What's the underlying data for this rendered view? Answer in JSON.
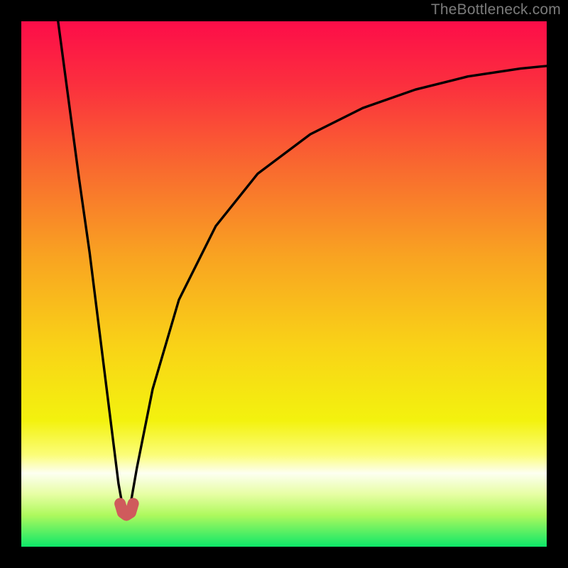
{
  "watermark": "TheBottleneck.com",
  "colors": {
    "frame": "#000000",
    "curve": "#000000",
    "marker": "#cf5b5c",
    "marker_outline": "#b94a4b",
    "gradient_stops": [
      {
        "offset": 0.0,
        "color": "#fd0d49"
      },
      {
        "offset": 0.12,
        "color": "#fb2f3e"
      },
      {
        "offset": 0.28,
        "color": "#f96a2f"
      },
      {
        "offset": 0.45,
        "color": "#f9a421"
      },
      {
        "offset": 0.62,
        "color": "#f9d317"
      },
      {
        "offset": 0.76,
        "color": "#f3f20e"
      },
      {
        "offset": 0.825,
        "color": "#fbfd78"
      },
      {
        "offset": 0.86,
        "color": "#fdfff1"
      },
      {
        "offset": 0.9,
        "color": "#e7fea4"
      },
      {
        "offset": 0.94,
        "color": "#aef95d"
      },
      {
        "offset": 1.0,
        "color": "#0de769"
      }
    ]
  },
  "chart_data": {
    "type": "line",
    "title": "",
    "xlabel": "",
    "ylabel": "",
    "xlim": [
      0,
      100
    ],
    "ylim": [
      0,
      100
    ],
    "grid": false,
    "legend": false,
    "minimum": {
      "x": 20,
      "y": 6
    },
    "marker_points": [
      {
        "x": 18.8,
        "y": 8.2
      },
      {
        "x": 19.3,
        "y": 6.5
      },
      {
        "x": 20.0,
        "y": 6.0
      },
      {
        "x": 20.8,
        "y": 6.5
      },
      {
        "x": 21.3,
        "y": 8.2
      }
    ],
    "series": [
      {
        "name": "bottleneck-curve",
        "branch": "left",
        "points": [
          {
            "x": 7.0,
            "y": 100.0
          },
          {
            "x": 9.0,
            "y": 85.0
          },
          {
            "x": 11.0,
            "y": 70.0
          },
          {
            "x": 13.0,
            "y": 56.0
          },
          {
            "x": 15.0,
            "y": 40.0
          },
          {
            "x": 17.0,
            "y": 24.0
          },
          {
            "x": 18.5,
            "y": 12.0
          },
          {
            "x": 19.4,
            "y": 7.0
          },
          {
            "x": 20.0,
            "y": 6.0
          }
        ]
      },
      {
        "name": "bottleneck-curve",
        "branch": "right",
        "points": [
          {
            "x": 20.0,
            "y": 6.0
          },
          {
            "x": 20.6,
            "y": 7.0
          },
          {
            "x": 22.0,
            "y": 15.0
          },
          {
            "x": 25.0,
            "y": 30.0
          },
          {
            "x": 30.0,
            "y": 47.0
          },
          {
            "x": 37.0,
            "y": 61.0
          },
          {
            "x": 45.0,
            "y": 71.0
          },
          {
            "x": 55.0,
            "y": 78.5
          },
          {
            "x": 65.0,
            "y": 83.5
          },
          {
            "x": 75.0,
            "y": 87.0
          },
          {
            "x": 85.0,
            "y": 89.5
          },
          {
            "x": 95.0,
            "y": 91.0
          },
          {
            "x": 100.0,
            "y": 91.5
          }
        ]
      }
    ]
  }
}
